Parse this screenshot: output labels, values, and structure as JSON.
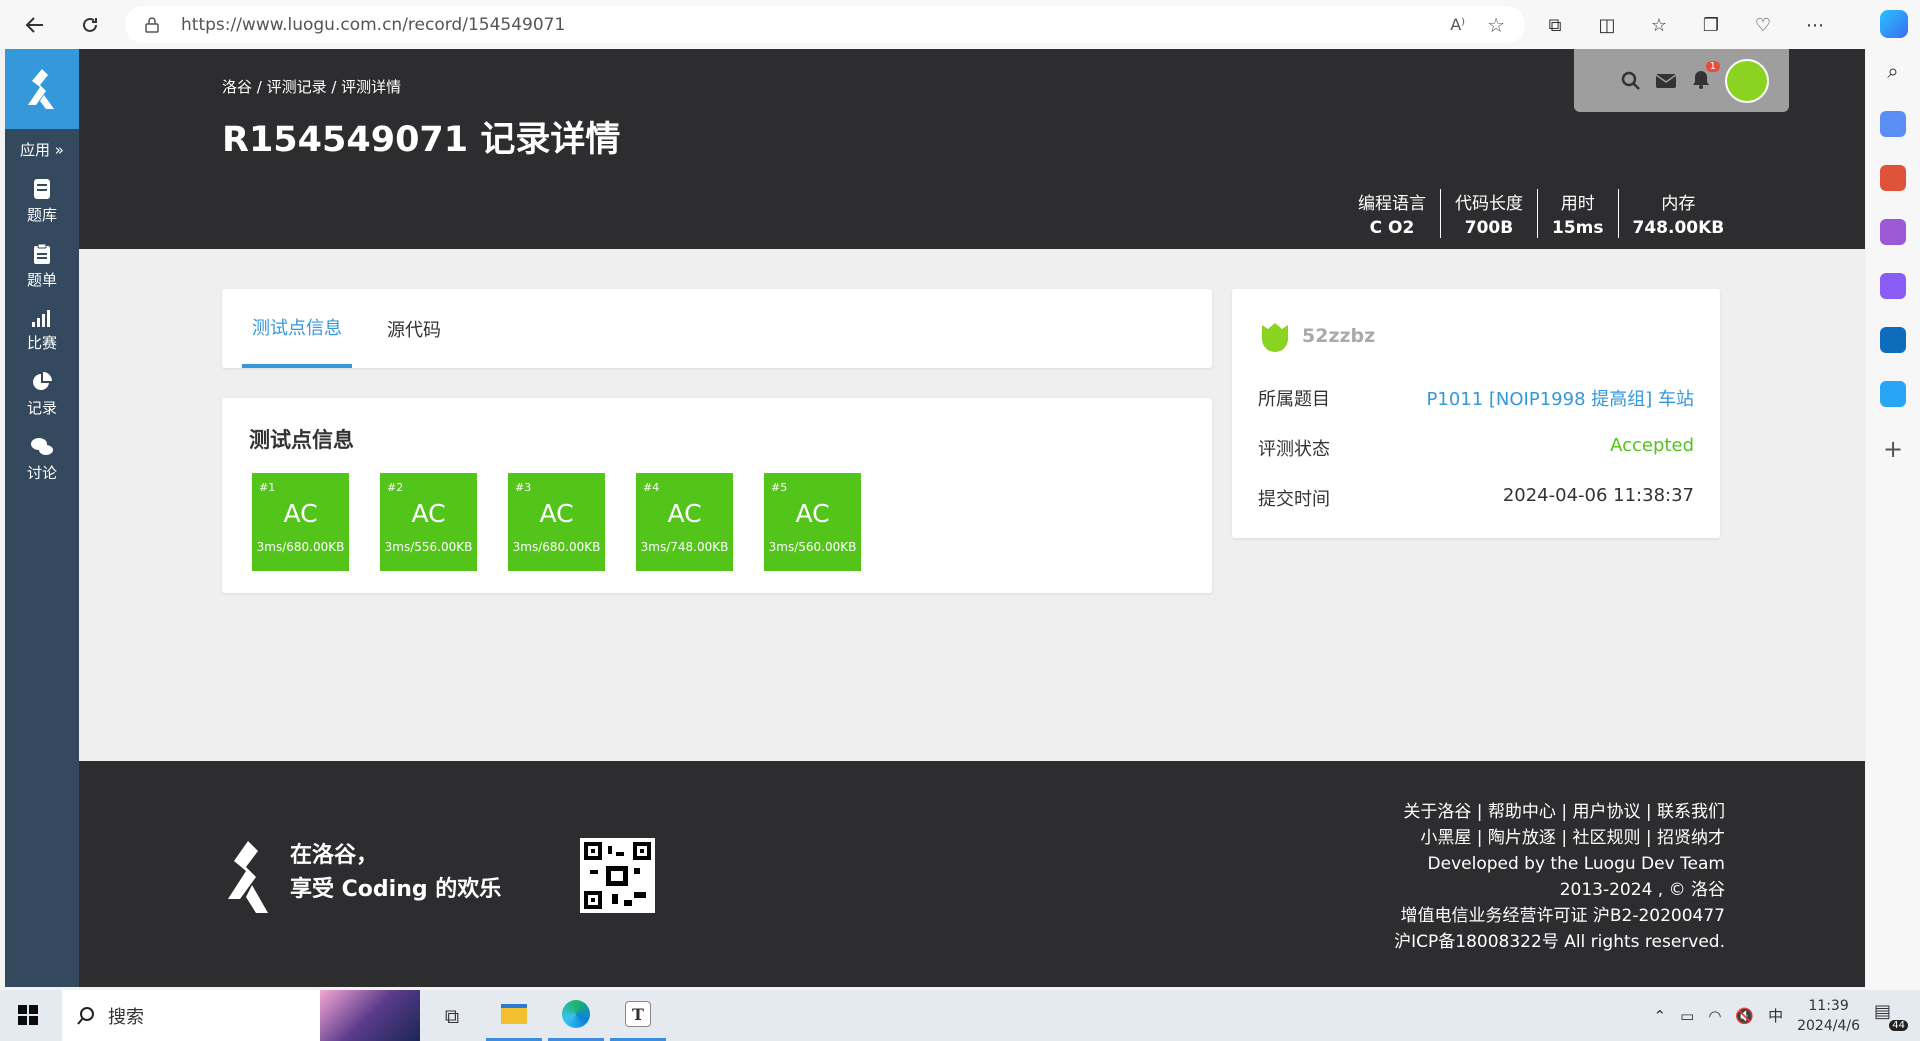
{
  "browser": {
    "url": "https://www.luogu.com.cn/record/154549071"
  },
  "sidebar": {
    "app_label": "应用",
    "items": [
      {
        "label": "题库"
      },
      {
        "label": "题单"
      },
      {
        "label": "比赛"
      },
      {
        "label": "记录"
      },
      {
        "label": "讨论"
      }
    ]
  },
  "header": {
    "breadcrumb": "洛谷 / 评测记录 / 评测详情",
    "title": "R154549071 记录详情",
    "notification_count": "1"
  },
  "stats": [
    {
      "label": "编程语言",
      "value": "C O2"
    },
    {
      "label": "代码长度",
      "value": "700B"
    },
    {
      "label": "用时",
      "value": "15ms"
    },
    {
      "label": "内存",
      "value": "748.00KB"
    }
  ],
  "tabs": [
    {
      "label": "测试点信息",
      "active": true
    },
    {
      "label": "源代码",
      "active": false
    }
  ],
  "testcases": {
    "heading": "测试点信息",
    "items": [
      {
        "id": "#1",
        "result": "AC",
        "detail": "3ms/680.00KB"
      },
      {
        "id": "#2",
        "result": "AC",
        "detail": "3ms/556.00KB"
      },
      {
        "id": "#3",
        "result": "AC",
        "detail": "3ms/680.00KB"
      },
      {
        "id": "#4",
        "result": "AC",
        "detail": "3ms/748.00KB"
      },
      {
        "id": "#5",
        "result": "AC",
        "detail": "3ms/560.00KB"
      }
    ]
  },
  "info": {
    "username": "52zzbz",
    "problem_label": "所属题目",
    "problem_value": "P1011 [NOIP1998 提高组] 车站",
    "status_label": "评测状态",
    "status_value": "Accepted",
    "time_label": "提交时间",
    "time_value": "2024-04-06 11:38:37"
  },
  "footer": {
    "slogan_line1": "在洛谷，",
    "slogan_line2": "享受 Coding 的欢乐",
    "links_line1": "关于洛谷 | 帮助中心 | 用户协议 | 联系我们",
    "links_line2": "小黑屋 | 陶片放逐 | 社区规则 | 招贤纳才",
    "dev_prefix": "Developed by the ",
    "dev_team": "Luogu Dev Team",
    "copyright": "2013-2024 , © 洛谷",
    "license": "增值电信业务经营许可证 沪B2-20200477",
    "icp": "沪ICP备18008322号 All rights reserved."
  },
  "taskbar": {
    "search_placeholder": "搜索",
    "ime": "中",
    "time": "11:39",
    "date": "2024/4/6",
    "notif": "44"
  },
  "colors": {
    "accent": "#3498db",
    "ac": "#52c41a",
    "accepted": "#52c41a",
    "dark": "#2d2d2f",
    "sidebar": "#34495e"
  }
}
